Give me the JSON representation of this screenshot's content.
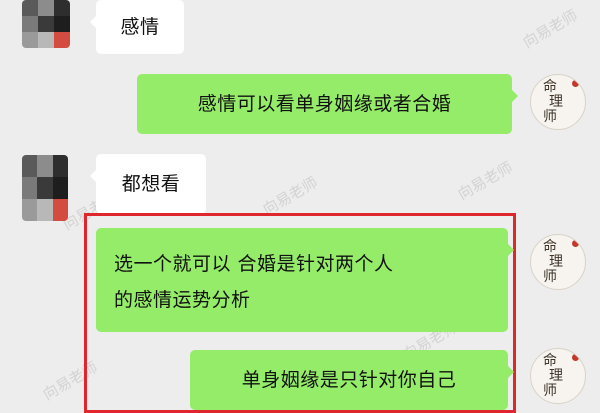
{
  "conversation": {
    "messages": [
      {
        "side": "left",
        "text": "感情"
      },
      {
        "side": "right",
        "text": "感情可以看单身姻缘或者合婚"
      },
      {
        "side": "left",
        "text": "都想看"
      },
      {
        "side": "right",
        "line1": "选一个就可以 合婚是针对两个人",
        "line2": "的感情运势分析"
      },
      {
        "side": "right",
        "text": "单身姻缘是只针对你自己"
      }
    ]
  },
  "avatar": {
    "fortune_teller_lines": [
      "命",
      "理",
      "师"
    ],
    "user_pixel_colors": [
      "#5a5a5a",
      "#8c8c8c",
      "#2e2e2e",
      "#7a7a7a",
      "#3a3a3a",
      "#1e1e1e",
      "#9a9a9a",
      "#b8b8b8",
      "#d44b3f"
    ]
  },
  "watermark": {
    "text": "向易老师"
  },
  "colors": {
    "chat_background": "#ededed",
    "outgoing_bubble": "#95ec69",
    "incoming_bubble": "#ffffff",
    "highlight_frame": "#e0262d"
  }
}
